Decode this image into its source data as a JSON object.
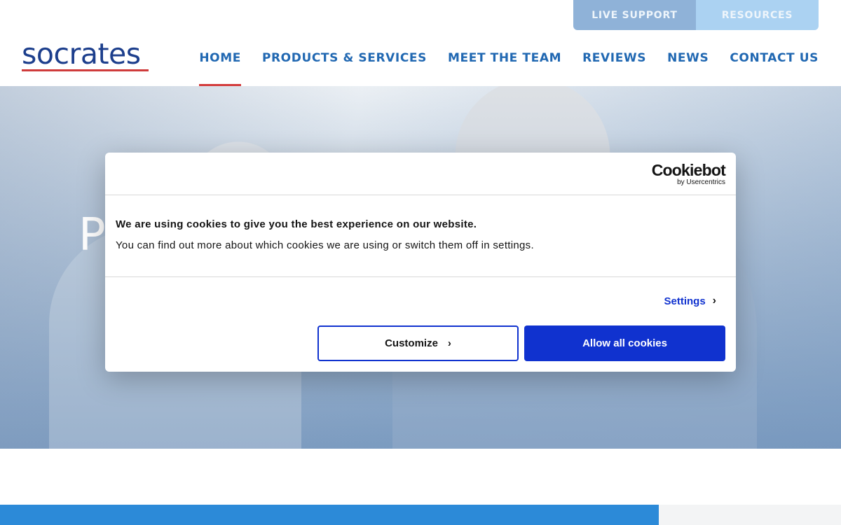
{
  "utility": {
    "live_support": "LIVE SUPPORT",
    "resources": "RESOURCES"
  },
  "logo": {
    "text": "socrates"
  },
  "nav": {
    "items": [
      {
        "label": "HOME",
        "active": true
      },
      {
        "label": "PRODUCTS & SERVICES"
      },
      {
        "label": "MEET THE TEAM"
      },
      {
        "label": "REVIEWS"
      },
      {
        "label": "NEWS"
      },
      {
        "label": "CONTACT US"
      }
    ]
  },
  "hero": {
    "title_visible": "P                                                            e"
  },
  "cookie": {
    "brand": "Cookiebot",
    "brand_sub": "by Usercentrics",
    "heading": "We are using cookies to give you the best experience on our website.",
    "text": "You can find out more about which cookies we are using or switch them off in settings.",
    "settings_label": "Settings",
    "customize_label": "Customize",
    "allow_label": "Allow all cookies"
  },
  "colors": {
    "brand_blue": "#1c3e8c",
    "nav_blue": "#2168b2",
    "accent_red": "#d33b3b",
    "cookie_blue": "#1032cf"
  }
}
